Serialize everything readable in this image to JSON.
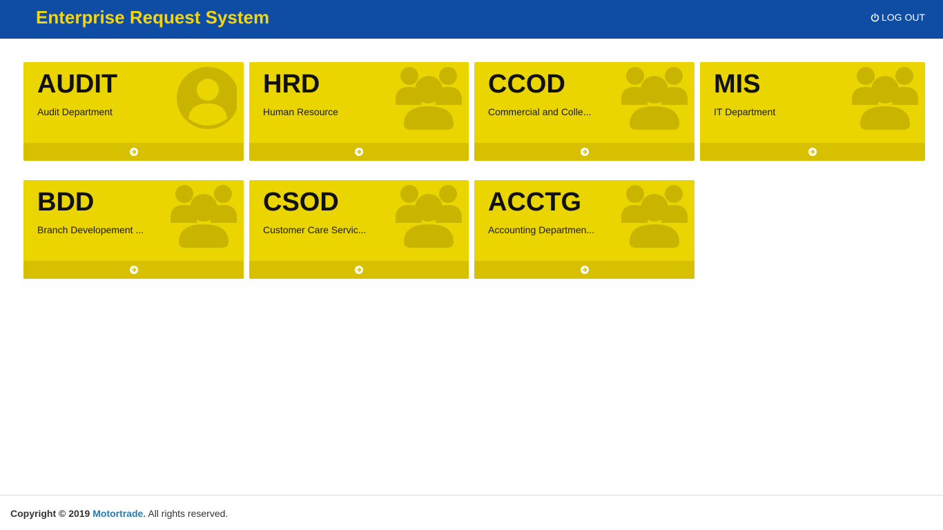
{
  "header": {
    "title": "Enterprise Request System",
    "logout_label": "LOG OUT"
  },
  "colors": {
    "header_bg": "#0f4ca3",
    "brand_text": "#f2d612",
    "tile_bg": "#ead500",
    "tile_footer": "#d7c000",
    "tile_icon": "#c9b400"
  },
  "departments": [
    {
      "code": "AUDIT",
      "description": "Audit Department",
      "icon": "user-icon"
    },
    {
      "code": "HRD",
      "description": "Human Resource",
      "icon": "users-icon"
    },
    {
      "code": "CCOD",
      "description": "Commercial and Colle...",
      "icon": "users-icon"
    },
    {
      "code": "MIS",
      "description": "IT Department",
      "icon": "users-icon"
    },
    {
      "code": "BDD",
      "description": "Branch Developement ...",
      "icon": "users-icon"
    },
    {
      "code": "CSOD",
      "description": "Customer Care Servic...",
      "icon": "users-icon"
    },
    {
      "code": "ACCTG",
      "description": "Accounting Departmen...",
      "icon": "users-icon"
    }
  ],
  "footer": {
    "copyright_prefix": "Copyright © 2019",
    "company": "Motortrade.",
    "suffix": "All rights reserved."
  }
}
